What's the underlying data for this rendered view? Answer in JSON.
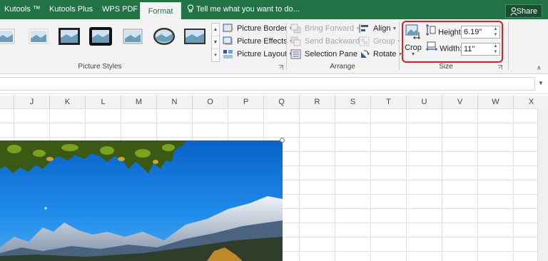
{
  "tabs": [
    {
      "label": "Kutools ™",
      "active": false
    },
    {
      "label": "Kutools Plus",
      "active": false
    },
    {
      "label": "WPS PDF",
      "active": false
    },
    {
      "label": "Format",
      "active": true
    }
  ],
  "tell_me": "Tell me what you want to do...",
  "share_label": "Share",
  "picture_styles": {
    "group_label": "Picture Styles",
    "gallery_count": 6
  },
  "picture_buttons": {
    "border": "Picture Border",
    "effects": "Picture Effects",
    "layout": "Picture Layout"
  },
  "arrange": {
    "group_label": "Arrange",
    "bring_forward": "Bring Forward",
    "send_backward": "Send Backward",
    "selection_pane": "Selection Pane",
    "align": "Align",
    "group": "Group",
    "rotate": "Rotate"
  },
  "size": {
    "group_label": "Size",
    "crop_label": "Crop",
    "height_label": "Height:",
    "height_value": "6.19\"",
    "width_label": "Width:",
    "width_value": "11\""
  },
  "columns": [
    "J",
    "K",
    "L",
    "M",
    "N",
    "O",
    "P",
    "Q",
    "R",
    "S",
    "T",
    "U",
    "V",
    "W",
    "X"
  ],
  "colors": {
    "ribbon_tab_green": "#217346",
    "highlight_red": "#e02020"
  }
}
